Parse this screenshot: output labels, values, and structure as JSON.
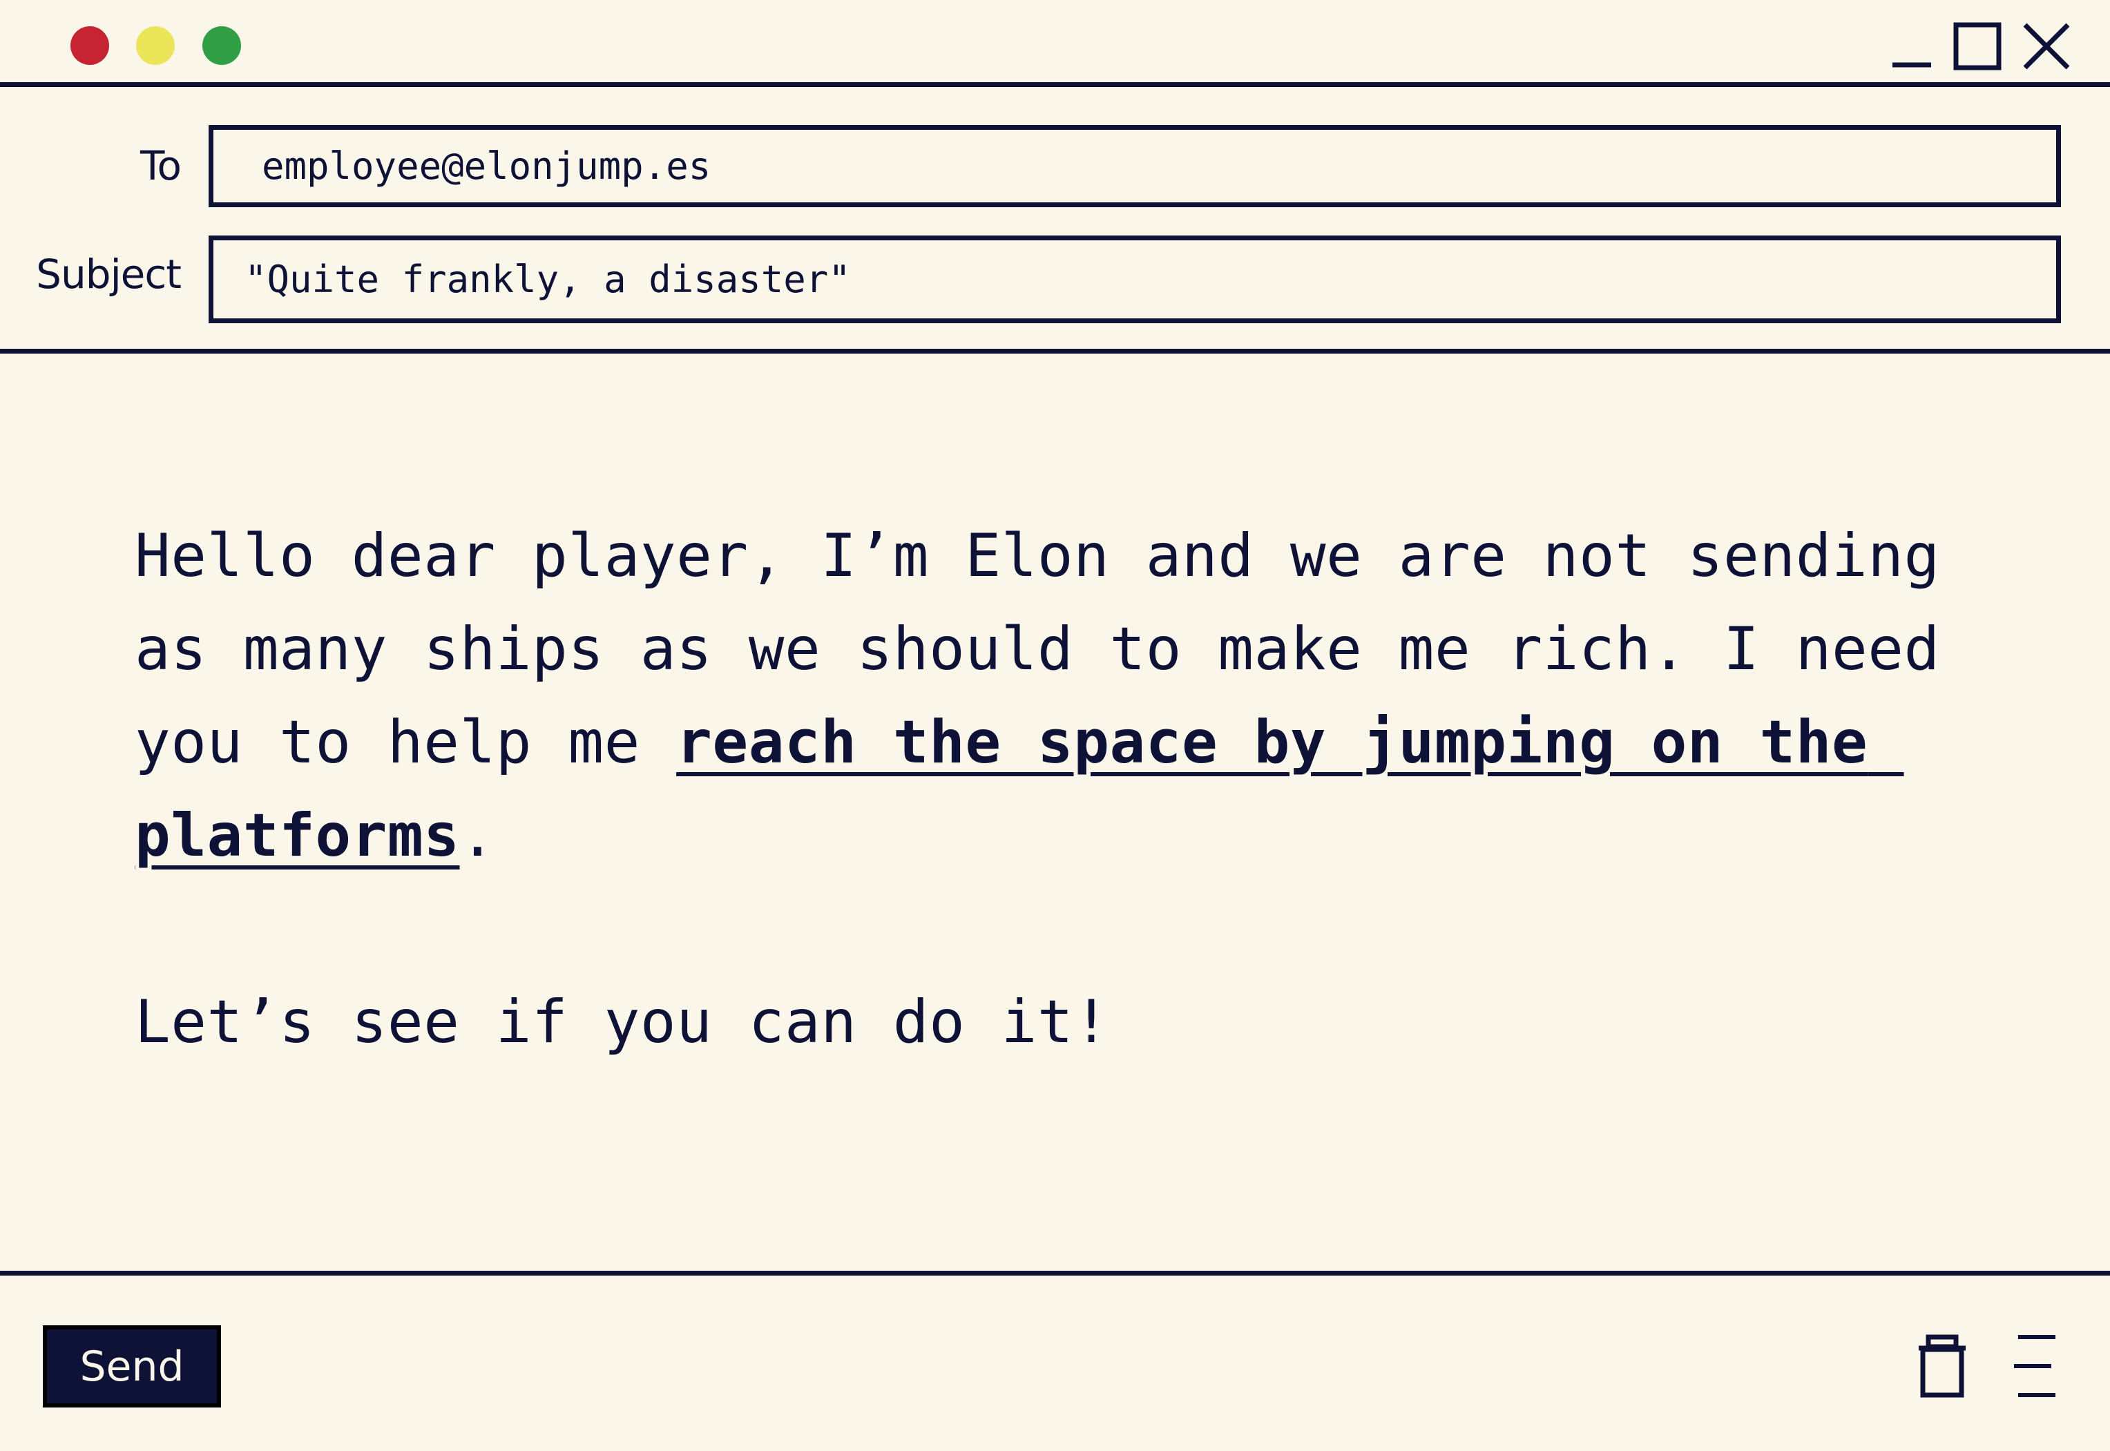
{
  "window": {
    "controls": {
      "close_color": "#c62333",
      "minimize_color": "#ebe55a",
      "maximize_color": "#2f9e44",
      "icons": [
        "minimize-icon",
        "maximize-icon",
        "close-icon"
      ]
    }
  },
  "compose": {
    "to_label": "To",
    "to_value": "employee@elonjump.es",
    "subject_label": "Subject",
    "subject_value": "\"Quite frankly, a disaster\""
  },
  "message": {
    "intro": "Hello dear player, I’m Elon and we are not sending as many ships as we should to make me rich. I need you to help me ",
    "link_text": "reach the space by jumping on the platforms",
    "after_link": ".",
    "closing": "Let’s see if you can do it!"
  },
  "footer": {
    "send_label": "Send",
    "icons": [
      "trash-icon",
      "menu-icon"
    ]
  },
  "colors": {
    "background": "#faf6ea",
    "ink": "#0e1236"
  }
}
